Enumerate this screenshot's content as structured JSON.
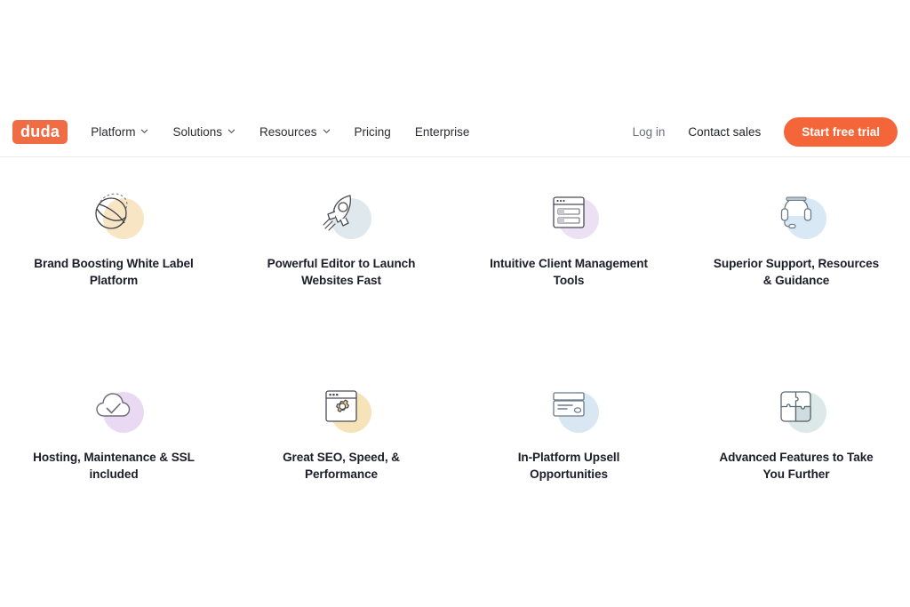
{
  "brand": {
    "logo_text": "duda",
    "logo_color": "#ef6c45"
  },
  "nav": {
    "links": [
      {
        "label": "Platform",
        "has_dropdown": true,
        "icon": "chevron-down-icon"
      },
      {
        "label": "Solutions",
        "has_dropdown": true,
        "icon": "chevron-down-icon"
      },
      {
        "label": "Resources",
        "has_dropdown": true,
        "icon": "chevron-down-icon"
      },
      {
        "label": "Pricing",
        "has_dropdown": false
      },
      {
        "label": "Enterprise",
        "has_dropdown": false
      }
    ],
    "login_label": "Log in",
    "contact_label": "Contact sales",
    "cta_label": "Start free trial",
    "cta_color": "#f4663a"
  },
  "features": {
    "rows": [
      [
        {
          "title": "Brand Boosting White Label Platform",
          "icon": "sphere-globe-icon",
          "blob_color": "#f7e5c4"
        },
        {
          "title": "Powerful Editor to Launch Websites Fast",
          "icon": "rocket-icon",
          "blob_color": "#dfe8ec"
        },
        {
          "title": "Intuitive Client Management Tools",
          "icon": "browser-list-icon",
          "blob_color": "#ece0f5"
        },
        {
          "title": "Superior Support, Resources & Guidance",
          "icon": "headset-icon",
          "blob_color": "#d9e8f5"
        }
      ],
      [
        {
          "title": "Hosting, Maintenance & SSL included",
          "icon": "cloud-check-icon",
          "blob_color": "#ead9f2"
        },
        {
          "title": "Great SEO, Speed, & Performance",
          "icon": "browser-gear-icon",
          "blob_color": "#f7e3b9"
        },
        {
          "title": "In-Platform Upsell Opportunities",
          "icon": "credit-card-icon",
          "blob_color": "#d9e7f3"
        },
        {
          "title": "Advanced Features to Take You Further",
          "icon": "puzzle-pieces-icon",
          "blob_color": "#dde9e9"
        }
      ]
    ]
  }
}
